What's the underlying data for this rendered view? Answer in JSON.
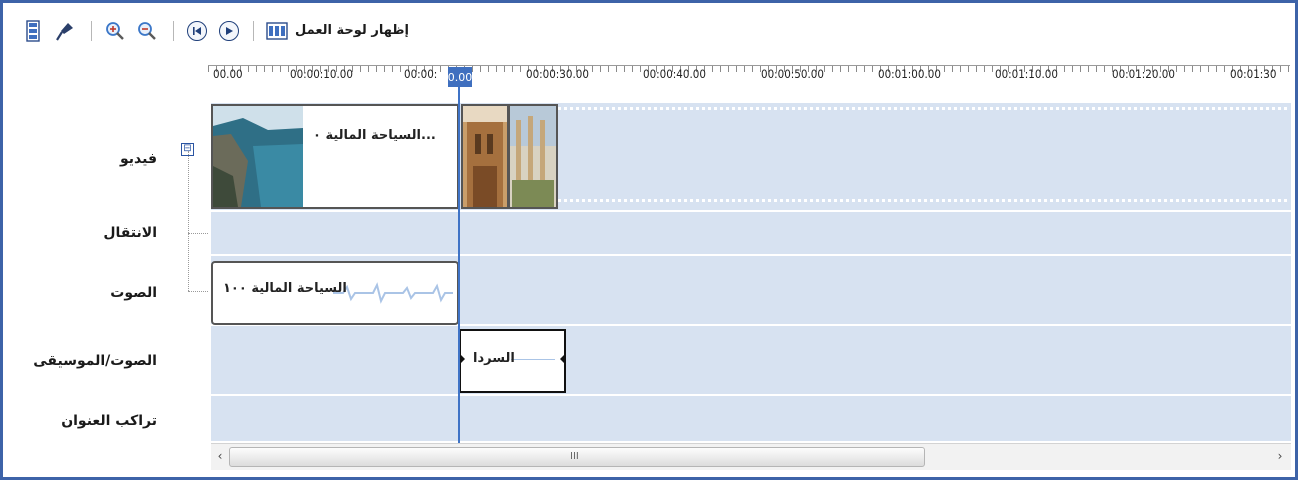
{
  "toolbar": {
    "show_storyboard_label": "إظهار لوحة العمل",
    "buttons": [
      "storyboard-view-icon",
      "narrate-timeline-icon",
      "zoom-in-icon",
      "zoom-out-icon",
      "rewind-icon",
      "play-icon",
      "storyboard-toggle-icon"
    ]
  },
  "ruler": {
    "ticks": [
      "00.00",
      "00:00:10.00",
      "00:00:",
      "00:00:30.00",
      "00:00:40.00",
      "00:00:50.00",
      "00:01:00.00",
      "00:01:10.00",
      "00:01:20.00",
      "00:01:30"
    ],
    "playhead_label": "0.00"
  },
  "tracks": {
    "video": "فيديو",
    "transition": "الانتقال",
    "audio": "الصوت",
    "music": "الصوت/الموسيقى",
    "title_overlay": "تراكب العنوان",
    "collapse_symbol": "⊟"
  },
  "clips": {
    "video_clip_1": "...السياحة المالية ٠",
    "audio_clip_1": "السياحة المالية ١٠٠",
    "music_clip_1": "السردا"
  },
  "scrollbar": {
    "left_arrow": "‹",
    "right_arrow": "›",
    "grip": "III"
  },
  "colors": {
    "frame_border": "#3d63a8",
    "track_bg": "#d7e2f1",
    "playhead": "#3f73c6"
  }
}
